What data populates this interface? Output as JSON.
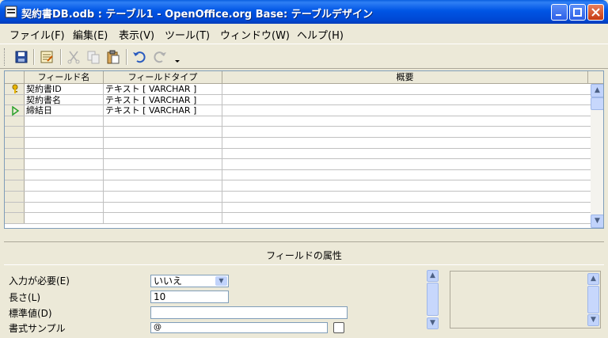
{
  "window": {
    "title": "契約書DB.odb : テーブル1 - OpenOffice.org Base: テーブルデザイン"
  },
  "menu": [
    {
      "label": "ファイル(F)"
    },
    {
      "label": "編集(E)"
    },
    {
      "label": "表示(V)"
    },
    {
      "label": "ツール(T)"
    },
    {
      "label": "ウィンドウ(W)"
    },
    {
      "label": "ヘルプ(H)"
    }
  ],
  "grid": {
    "columns": [
      "フィールド名",
      "フィールドタイプ",
      "概要"
    ],
    "rows": [
      {
        "name": "契約書ID",
        "type": "テキスト [ VARCHAR ]",
        "desc": "",
        "marker": "primary-key-icon"
      },
      {
        "name": "契約書名",
        "type": "テキスト [ VARCHAR ]",
        "desc": "",
        "marker": ""
      },
      {
        "name": "締結日",
        "type": "テキスト [ VARCHAR ]",
        "desc": "",
        "marker": "current-row-arrow-icon"
      }
    ]
  },
  "properties": {
    "title": "フィールドの属性",
    "required_label": "入力が必要(E)",
    "required_value": "いいえ",
    "length_label": "長さ(L)",
    "length_value": "10",
    "default_label": "標準値(D)",
    "default_value": "",
    "format_label": "書式サンプル",
    "format_value": "@"
  },
  "colors": {
    "titlebar": "#0055e5",
    "chrome": "#ece9d8",
    "primary_key": "#e8b400",
    "row_arrow": "#2aa12a"
  }
}
